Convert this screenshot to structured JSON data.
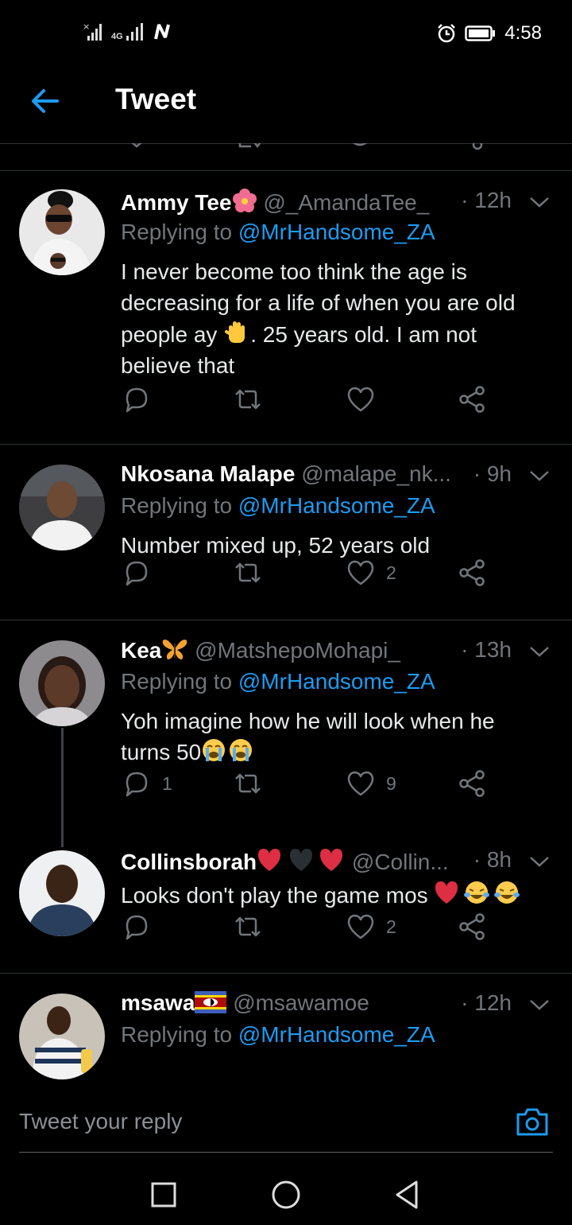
{
  "status_bar": {
    "time": "4:58",
    "network": "4G"
  },
  "header": {
    "title": "Tweet"
  },
  "tweets": [
    {
      "name": "Ammy Tee",
      "handle": "@_AmandaTee_",
      "time": "· 12h",
      "reply_prefix": "Replying to",
      "reply_to": "@MrHandsome_ZA",
      "text_parts": [
        "I never become too think the age is decreasing for a life of when you are old people ay",
        ". 25 years old. I am not believe that"
      ],
      "replies": "",
      "retweets": "",
      "likes": ""
    },
    {
      "name": "Nkosana Malape",
      "handle": "@malape_nk...",
      "time": "· 9h",
      "reply_prefix": "Replying to",
      "reply_to": "@MrHandsome_ZA",
      "text": "Number mixed up, 52 years old",
      "replies": "",
      "retweets": "",
      "likes": "2"
    },
    {
      "name": "Kea",
      "handle": "@MatshepoMohapi_",
      "time": "· 13h",
      "reply_prefix": "Replying to",
      "reply_to": "@MrHandsome_ZA",
      "text": "Yoh imagine how he will look when he turns 50",
      "replies": "1",
      "retweets": "",
      "likes": "9"
    },
    {
      "name": "Collinsborah",
      "handle": "@Collin...",
      "time": "· 8h",
      "text": "Looks don't play the game mos",
      "replies": "",
      "retweets": "",
      "likes": "2"
    },
    {
      "name": "msawa",
      "handle": "@msawamoe",
      "time": "· 12h",
      "reply_prefix": "Replying to",
      "reply_to": "@MrHandsome_ZA"
    }
  ],
  "reply_bar": {
    "placeholder": "Tweet your reply"
  },
  "colors": {
    "accent": "#1d9bf0",
    "secondary_text": "#71767b",
    "divider": "#2f3336",
    "background": "#000000"
  }
}
